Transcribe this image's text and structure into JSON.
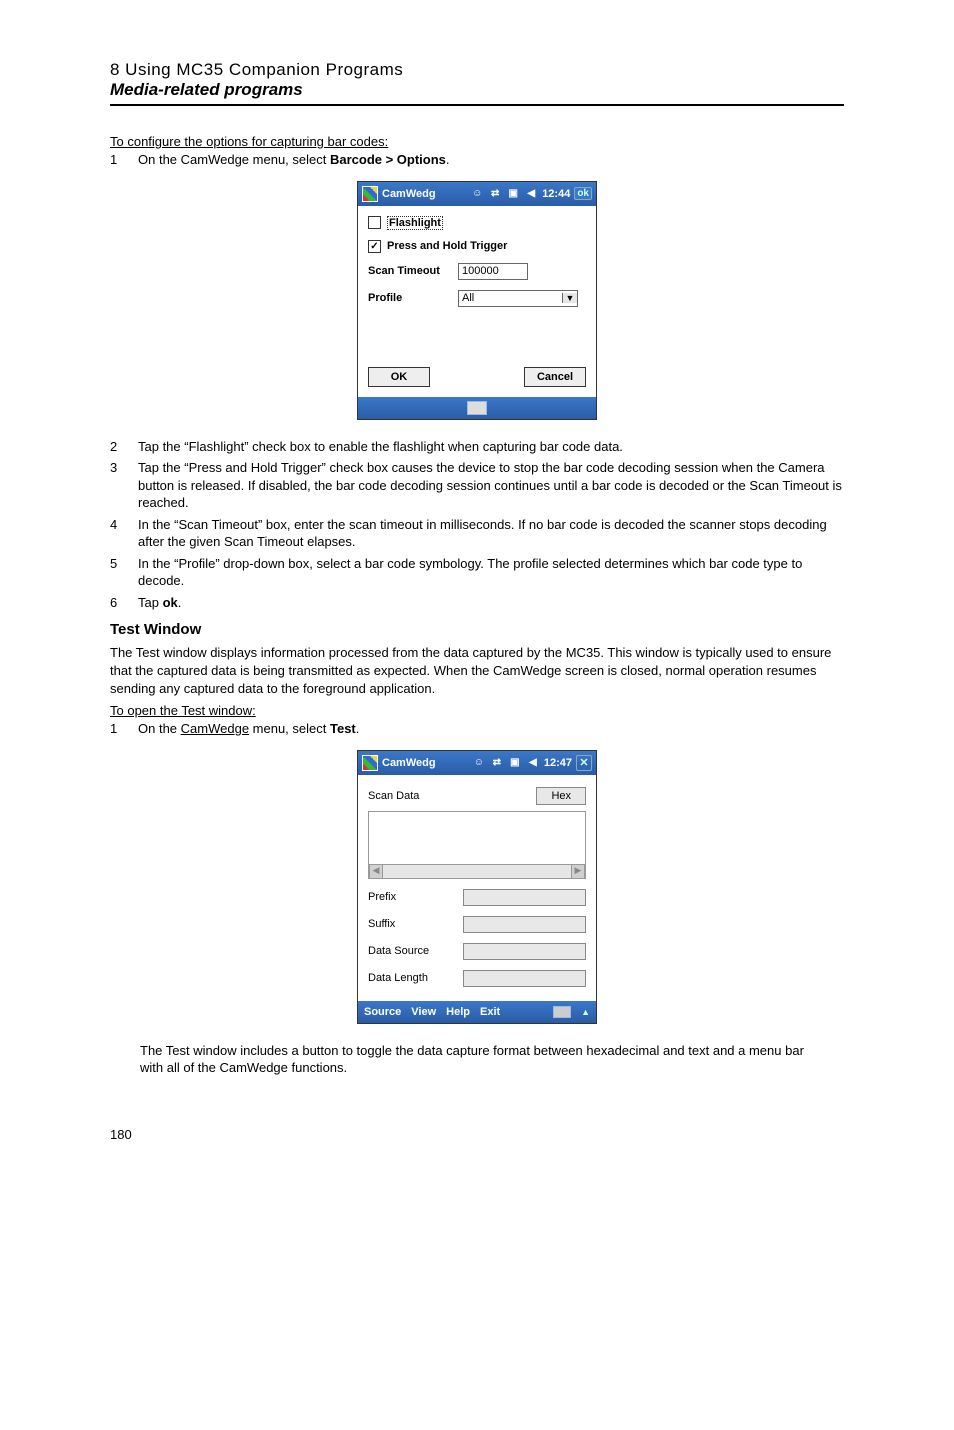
{
  "header": {
    "chapter": "8 Using MC35 Companion Programs",
    "section": "Media-related programs"
  },
  "intro1": {
    "heading": "To configure the options for capturing bar codes:",
    "steps": [
      {
        "n": "1",
        "t_before": "On the CamWedge menu, select ",
        "t_bold": "Barcode > Options",
        "t_after": "."
      }
    ]
  },
  "win1": {
    "title": "CamWedg",
    "time": "12:44",
    "ok": "ok",
    "flashlight": "Flashlight",
    "pressHold": "Press and Hold Trigger",
    "scanTimeoutLabel": "Scan Timeout",
    "scanTimeoutValue": "100000",
    "profileLabel": "Profile",
    "profileValue": "All",
    "okBtn": "OK",
    "cancelBtn": "Cancel"
  },
  "steps_after1": [
    {
      "n": "2",
      "text": "Tap the “Flashlight” check box to enable the flashlight when capturing bar code data."
    },
    {
      "n": "3",
      "text": "Tap the “Press and Hold Trigger” check box causes the device to stop the bar code decoding session when the Camera button is released. If disabled, the bar code decoding session continues until a bar code is decoded or the Scan Timeout is reached."
    },
    {
      "n": "4",
      "text": "In the “Scan Timeout” box, enter the scan timeout in milliseconds. If no bar code is decoded the scanner stops decoding after the given Scan Timeout elapses."
    },
    {
      "n": "5",
      "text": "In the “Profile” drop-down box, select a bar code symbology. The profile selected determines which bar code type to decode."
    }
  ],
  "step6": {
    "n": "6",
    "before": "Tap ",
    "bold": "ok",
    "after": "."
  },
  "testWindow": {
    "heading": "Test Window",
    "paragraph": "The Test window displays information processed from the data captured by the MC35. This window is typically used to ensure that the captured data is being transmitted as expected. When the CamWedge screen is closed, normal operation resumes sending any captured data to the foreground application.",
    "openHeading": "To open the Test window:",
    "step1_n": "1",
    "step1_before": "On the ",
    "step1_underlined": "CamWedge",
    "step1_mid": " menu, select ",
    "step1_bold": "Test",
    "step1_after": "."
  },
  "win2": {
    "title": "CamWedg",
    "time": "12:47",
    "scanData": "Scan Data",
    "hex": "Hex",
    "prefix": "Prefix",
    "suffix": "Suffix",
    "dataSource": "Data Source",
    "dataLength": "Data Length",
    "menu": {
      "source": "Source",
      "view": "View",
      "help": "Help",
      "exit": "Exit"
    }
  },
  "caption2": "The Test window includes a button to toggle the data capture format between hexadecimal and text and a menu bar with all of the CamWedge functions.",
  "pageNumber": "180"
}
